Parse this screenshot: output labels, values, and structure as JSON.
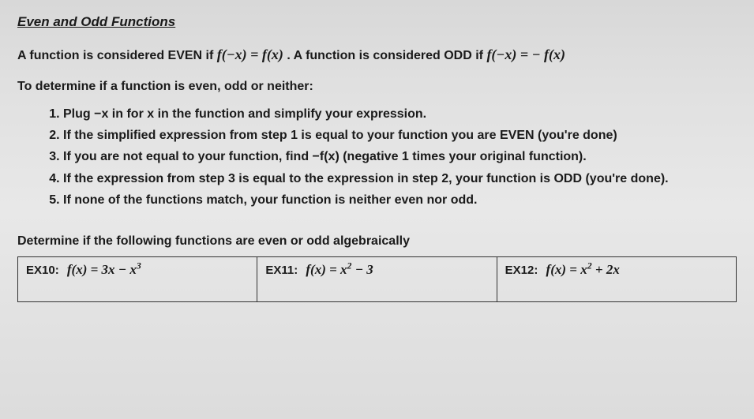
{
  "title": "Even and Odd Functions",
  "intro_part1": "A function is considered EVEN if ",
  "intro_math1": "f(−x) = f(x)",
  "intro_part2": ".  A function is considered ODD if ",
  "intro_math2": "f(−x) = − f(x)",
  "subheading": "To determine if a function is even, odd or neither:",
  "steps": [
    "Plug −x in for x in the function and simplify your expression.",
    "If the simplified expression from step 1 is equal to your function you are EVEN (you're done)",
    "If you are not equal to your function, find −f(x) (negative 1 times your original function).",
    "If the expression from step 3 is equal to the expression in step 2, your function is ODD (you're done).",
    "If none of the functions match, your function is neither even nor odd."
  ],
  "determine": "Determine if the following functions are even or odd algebraically",
  "examples": [
    {
      "label": "EX10:",
      "fn_html": "f(x) = 3x − x<sup>3</sup>"
    },
    {
      "label": "EX11:",
      "fn_html": "f(x) = x<sup>2</sup> − 3"
    },
    {
      "label": "EX12:",
      "fn_html": "f(x) = x<sup>2</sup> + 2x"
    }
  ]
}
